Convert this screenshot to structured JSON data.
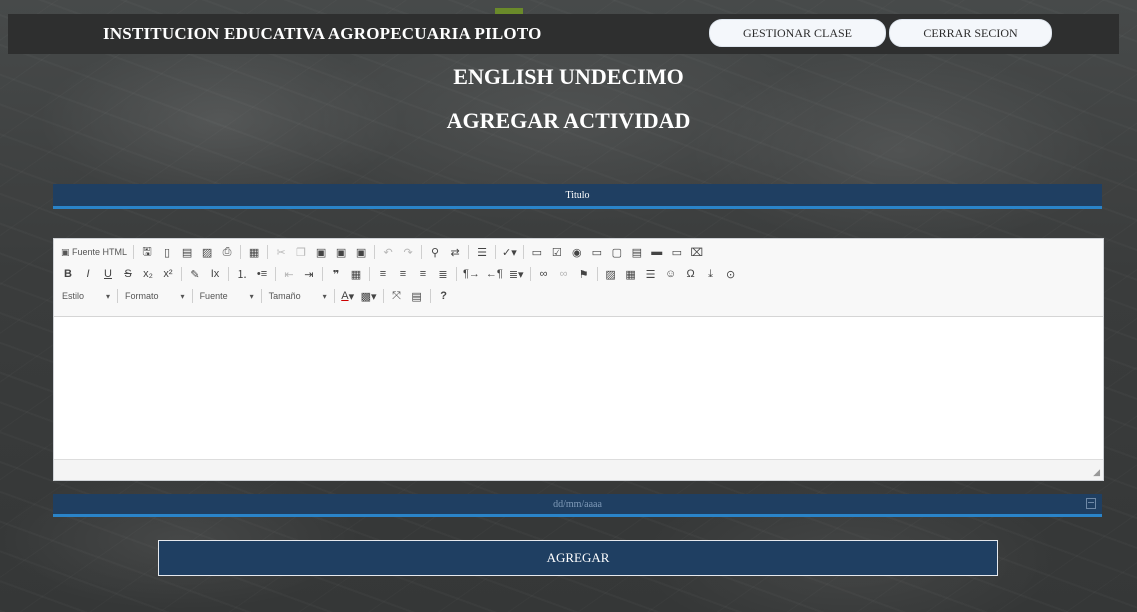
{
  "header": {
    "school_name": "INSTITUCION EDUCATIVA AGROPECUARIA PILOTO",
    "buttons": {
      "gestionar": "GESTIONAR CLASE",
      "cerrar": "CERRAR SECION"
    }
  },
  "page": {
    "course": "ENGLISH UNDECIMO",
    "action": "AGREGAR ACTIVIDAD"
  },
  "form": {
    "title_placeholder": "Titulo",
    "date_placeholder": "dd/mm/aaaa",
    "submit_label": "AGREGAR"
  },
  "editor": {
    "source_label": "Fuente HTML",
    "row1": [
      "save",
      "new-page",
      "templates",
      "preview",
      "print",
      "paste-template",
      "cut",
      "copy",
      "paste",
      "paste-text",
      "paste-word",
      "undo",
      "redo",
      "find",
      "replace",
      "select-all",
      "spellcheck",
      "form",
      "checkbox",
      "radio",
      "textfield",
      "textarea",
      "select",
      "button",
      "image-button",
      "hidden-field"
    ],
    "row2": [
      "bold",
      "italic",
      "underline",
      "strikethrough",
      "subscript",
      "superscript",
      "copy-format",
      "remove-format",
      "numbered-list",
      "bulleted-list",
      "outdent",
      "indent",
      "blockquote",
      "div",
      "align-left",
      "align-center",
      "align-right",
      "justify",
      "ltr",
      "rtl",
      "language",
      "link",
      "unlink",
      "anchor",
      "image",
      "table",
      "horizontal-line",
      "smiley",
      "special-char",
      "page-break",
      "iframe"
    ],
    "row2_glyphs": {
      "bold": "B",
      "italic": "I",
      "underline": "U",
      "strike": "S",
      "sub": "x₂",
      "sup": "x²",
      "omega": "Ω"
    },
    "combos": [
      "Estilo",
      "Formato",
      "Fuente",
      "Tamaño"
    ],
    "help": "?"
  },
  "colors": {
    "accent_blue": "#1f3f62",
    "underline_blue": "#2a84c9",
    "topbar": "#2e2f2f"
  }
}
